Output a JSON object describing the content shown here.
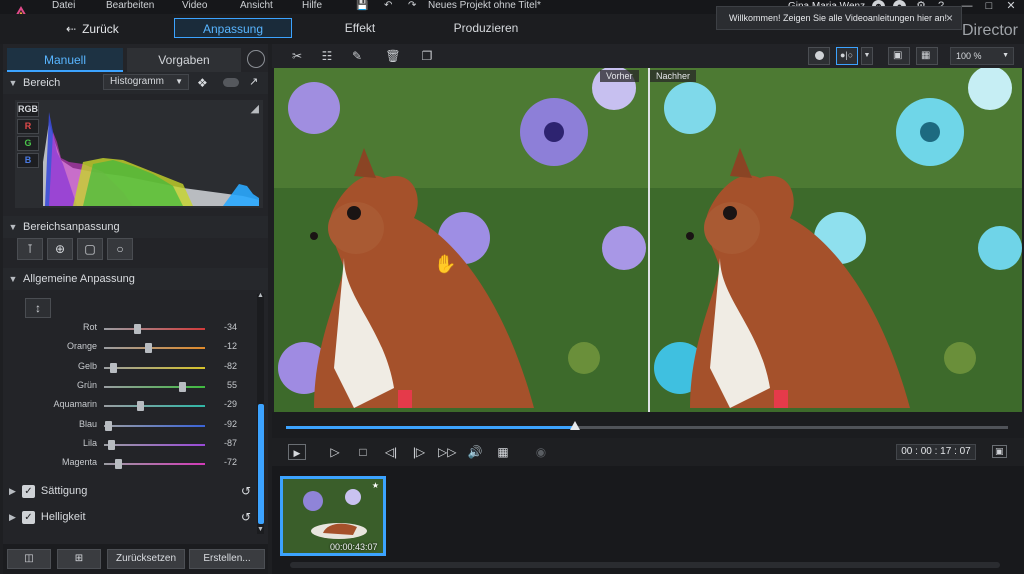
{
  "menu": {
    "items": [
      "Datei",
      "Bearbeiten",
      "Video",
      "Ansicht",
      "Hilfe"
    ],
    "project_title": "Neues Projekt ohne Titel*",
    "user_name": "Gina Maria Wenz",
    "help_label": "?"
  },
  "nav": {
    "back_label": "Zurück",
    "tabs": [
      "Anpassung",
      "Effekt",
      "Produzieren"
    ],
    "active_tab": "Anpassung"
  },
  "toast": {
    "text": "Willkommen! Zeigen Sie alle Videoanleitungen hier an!",
    "close_label": "×"
  },
  "brand": "Director",
  "left_panel": {
    "tabs": [
      "Manuell",
      "Vorgaben"
    ],
    "active_tab": "Manuell",
    "range_section": {
      "title": "Bereich",
      "dropdown_value": "Histogramm",
      "channels": [
        "RGB",
        "R",
        "G",
        "B"
      ]
    },
    "range_adjust_section": {
      "title": "Bereichsanpassung"
    },
    "general_section": {
      "title": "Allgemeine Anpassung",
      "sliders": [
        {
          "label": "Rot",
          "value": "-34",
          "level": -34,
          "color": "#d23a3a"
        },
        {
          "label": "Orange",
          "value": "-12",
          "level": -12,
          "color": "#e08a2a"
        },
        {
          "label": "Gelb",
          "value": "-82",
          "level": -82,
          "color": "#d7c32a"
        },
        {
          "label": "Grün",
          "value": "55",
          "level": 55,
          "color": "#3fbb3f"
        },
        {
          "label": "Aquamarin",
          "value": "-29",
          "level": -29,
          "color": "#2fb7a6"
        },
        {
          "label": "Blau",
          "value": "-92",
          "level": -92,
          "color": "#3a63d8"
        },
        {
          "label": "Lila",
          "value": "-87",
          "level": -87,
          "color": "#9a4ad8"
        },
        {
          "label": "Magenta",
          "value": "-72",
          "level": -72,
          "color": "#d23ab8"
        }
      ],
      "subsections": [
        {
          "label": "Sättigung",
          "checked": true
        },
        {
          "label": "Helligkeit",
          "checked": true
        }
      ]
    },
    "bottom_buttons": [
      "Zurücksetzen",
      "Erstellen..."
    ]
  },
  "preview": {
    "before_label": "Vorher",
    "after_label": "Nachher",
    "zoom": "100 %",
    "progress_percent": 40
  },
  "playback": {
    "timecode": "00 : 00 : 17 : 07"
  },
  "library": {
    "clip_duration": "00:00:43:07"
  },
  "colors": {
    "accent": "#3ca3ff",
    "panel": "#232428",
    "background": "#1e1f22"
  }
}
